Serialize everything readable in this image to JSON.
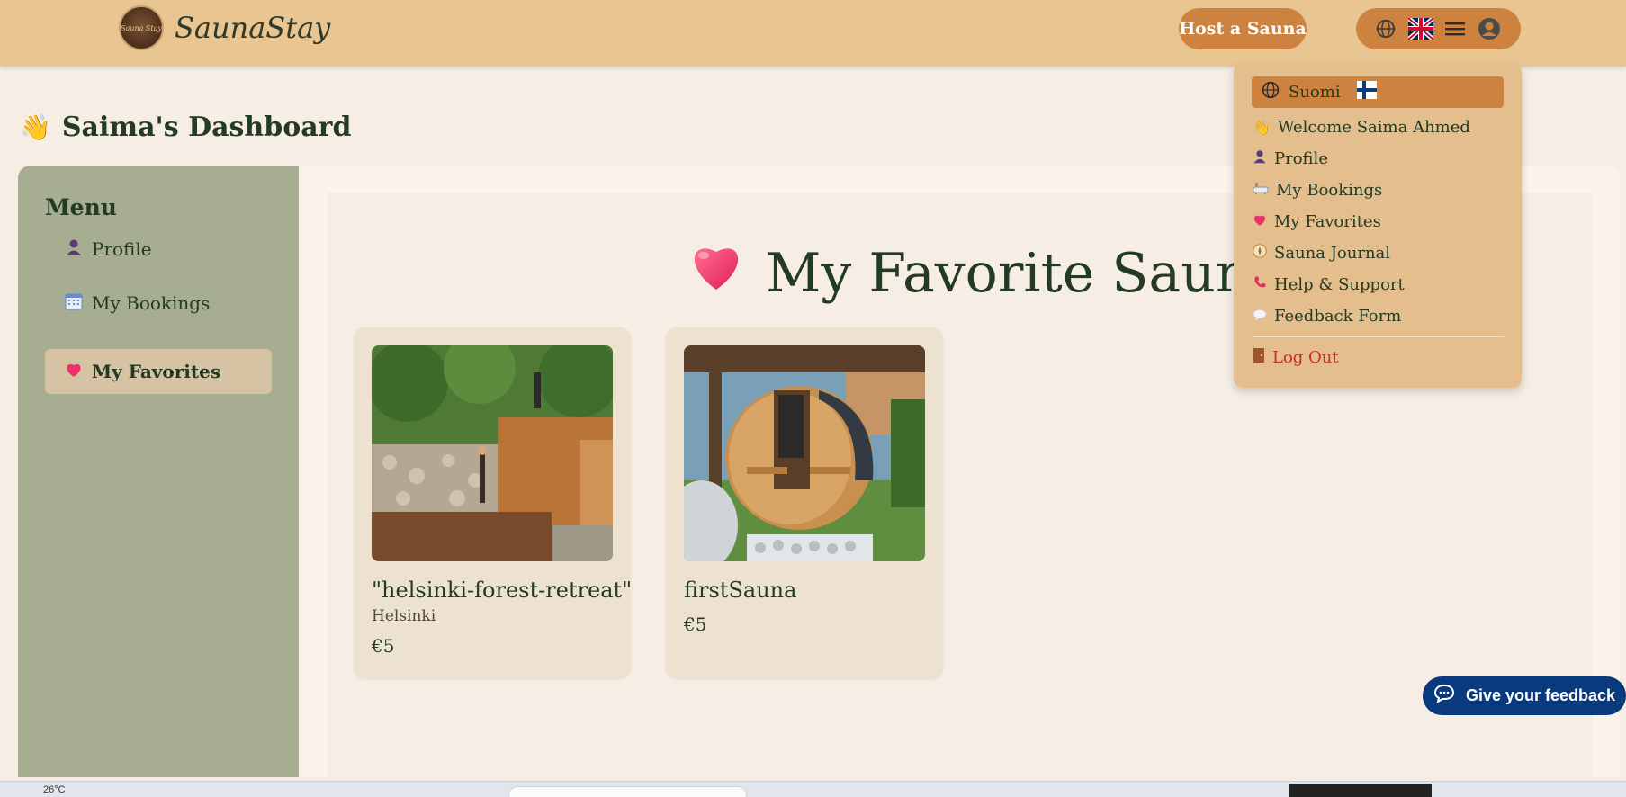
{
  "header": {
    "brand_name": "SaunaStay",
    "logo_text": "Sauna Stay",
    "host_button": "Host a Sauna",
    "icons": [
      "globe-icon",
      "uk-flag-icon",
      "hamburger-menu-icon",
      "user-avatar-icon"
    ]
  },
  "page": {
    "title": "Saima's Dashboard"
  },
  "sidebar": {
    "menu_title": "Menu",
    "items": [
      {
        "label": "Profile",
        "icon": "person-icon"
      },
      {
        "label": "My Bookings",
        "icon": "calendar-icon"
      },
      {
        "label": "My Favorites",
        "icon": "heart-icon",
        "active": true
      }
    ]
  },
  "main": {
    "heading": "My Favorite Saunas",
    "cards": [
      {
        "name": "\"helsinki-forest-retreat\"",
        "city": "Helsinki",
        "price": "€5"
      },
      {
        "name": "firstSauna",
        "city": "",
        "price": "€5"
      }
    ]
  },
  "dropdown": {
    "language": "Suomi",
    "items": [
      {
        "label": "Welcome Saima Ahmed",
        "icon": "wave-icon"
      },
      {
        "label": "Profile",
        "icon": "person-icon"
      },
      {
        "label": "My Bookings",
        "icon": "bathtub-icon"
      },
      {
        "label": "My Favorites",
        "icon": "heart-icon"
      },
      {
        "label": "Sauna Journal",
        "icon": "compass-icon"
      },
      {
        "label": "Help & Support",
        "icon": "phone-icon"
      },
      {
        "label": "Feedback Form",
        "icon": "speech-bubble-icon"
      }
    ],
    "logout": "Log Out"
  },
  "feedback_button": "Give your feedback",
  "taskbar": {
    "temperature": "26°C"
  },
  "colors": {
    "header_bg": "#e9c591",
    "accent": "#cd833f",
    "sidebar_bg": "#a7ad91",
    "feedback_bg": "#0a3a7e",
    "text_dark": "#233a24"
  }
}
